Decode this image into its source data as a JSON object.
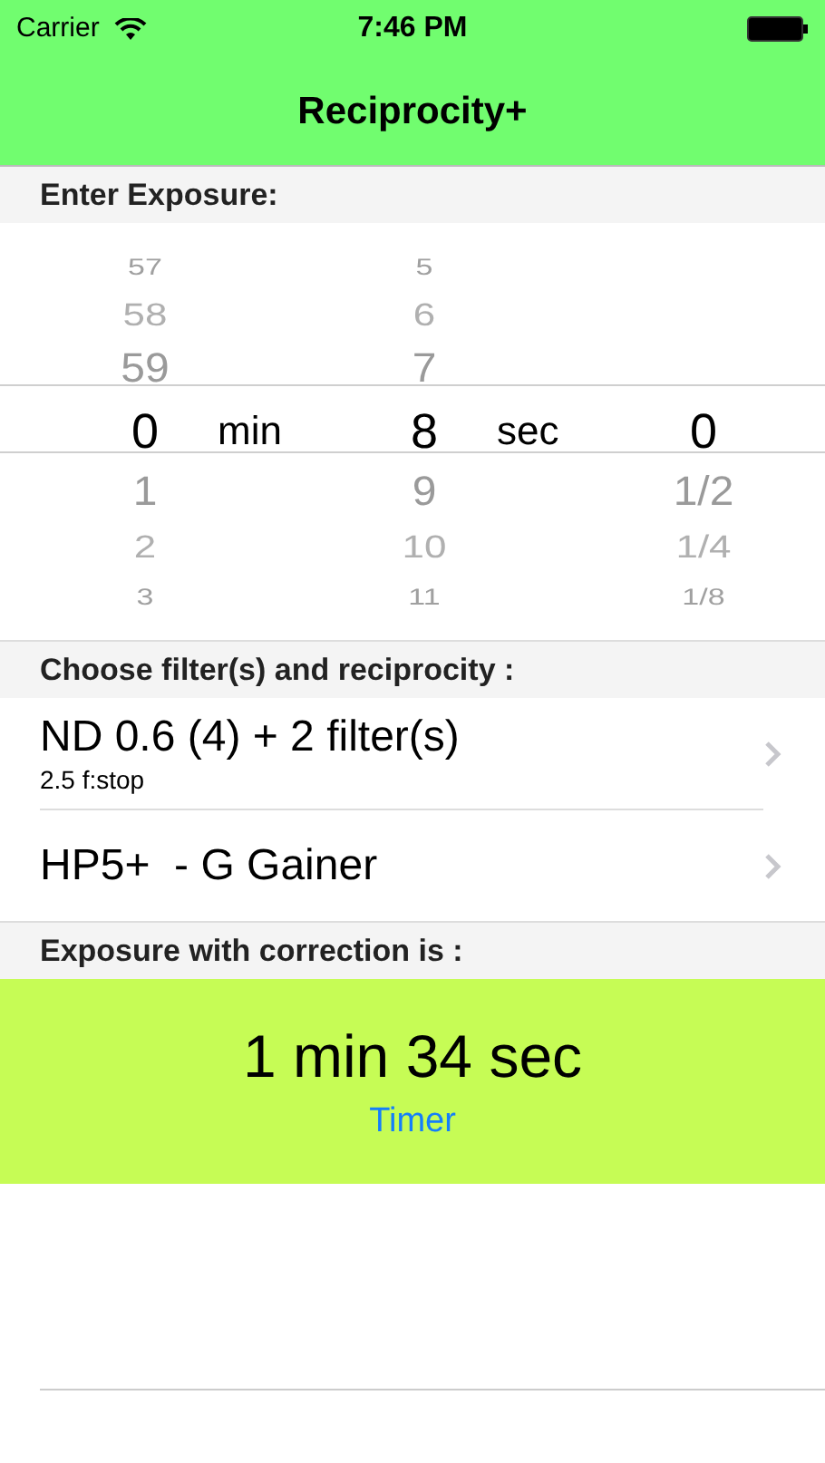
{
  "status_bar": {
    "carrier": "Carrier",
    "time": "7:46 PM"
  },
  "nav": {
    "title": "Reciprocity+"
  },
  "exposure_header": "Enter Exposure:",
  "wheels": [
    {
      "unit": "min",
      "items": [
        {
          "label": "57",
          "selected": false
        },
        {
          "label": "58",
          "selected": false
        },
        {
          "label": "59",
          "selected": false
        },
        {
          "label": "0",
          "selected": true
        },
        {
          "label": "1",
          "selected": false
        },
        {
          "label": "2",
          "selected": false
        },
        {
          "label": "3",
          "selected": false
        }
      ]
    },
    {
      "unit": "sec",
      "items": [
        {
          "label": "5",
          "selected": false
        },
        {
          "label": "6",
          "selected": false
        },
        {
          "label": "7",
          "selected": false
        },
        {
          "label": "8",
          "selected": true
        },
        {
          "label": "9",
          "selected": false
        },
        {
          "label": "10",
          "selected": false
        },
        {
          "label": "11",
          "selected": false
        }
      ]
    },
    {
      "items": [
        {
          "label": "0",
          "selected": true
        },
        {
          "label": "1/2",
          "selected": false
        },
        {
          "label": "1/4",
          "selected": false
        },
        {
          "label": "1/8",
          "selected": false
        }
      ]
    }
  ],
  "filter_header": "Choose filter(s) and reciprocity :",
  "rows": [
    {
      "title": "ND 0.6 (4) + 2 filter(s)",
      "subtitle": "2.5 f:stop"
    },
    {
      "title": "HP5+  - G Gainer"
    }
  ],
  "result_header": "Exposure with correction is :",
  "result": {
    "value": "1 min 34 sec",
    "button": "Timer"
  }
}
